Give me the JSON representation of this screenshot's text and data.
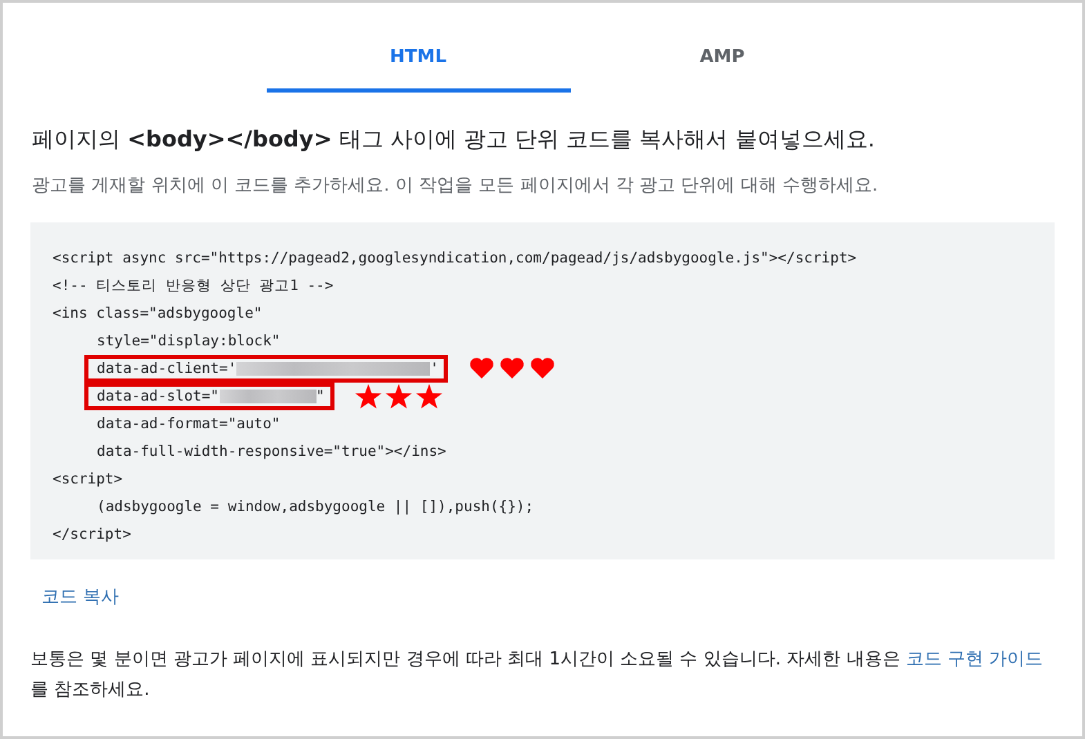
{
  "tabs": [
    {
      "label": "HTML",
      "selected": true
    },
    {
      "label": "AMP",
      "selected": false
    }
  ],
  "heading": "페이지의 **<body></body>** 태그 사이에 광고 단위 코드를 복사해서 붙여넣으세요.",
  "subtitle": "광고를 게재할 위치에 이 코드를 추가하세요. 이 작업을 모든 페이지에서 각 광고 단위에 대해 수행하세요.",
  "code_lines": [
    {
      "kind": "plain",
      "text": "<script async src=\"https://pagead2,googlesyndication,com/pagead/js/adsbygoogle.js\"></script>"
    },
    {
      "kind": "plain",
      "text": "<!-- 티스토리 반응형 상단 광고1 -->"
    },
    {
      "kind": "plain",
      "text": "<ins class=\"adsbygoogle\""
    },
    {
      "kind": "indented",
      "text": "style=\"display:block\""
    },
    {
      "kind": "indented",
      "text": "data-ad-client='",
      "redacted": true,
      "text_after": "'",
      "highlighted": true,
      "annotation": [
        {
          "kind": "heart"
        },
        {
          "kind": "heart"
        },
        {
          "kind": "heart"
        }
      ]
    },
    {
      "kind": "indented",
      "text": "data-ad-slot=\"",
      "redacted": true,
      "text_after": "\"",
      "highlighted": true,
      "annotation": [
        {
          "kind": "star"
        },
        {
          "kind": "star"
        },
        {
          "kind": "star"
        }
      ]
    },
    {
      "kind": "indented",
      "text": "data-ad-format=\"auto\""
    },
    {
      "kind": "indented",
      "text": "data-full-width-responsive=\"true\"></ins>"
    },
    {
      "kind": "plain",
      "text": "<script>"
    },
    {
      "kind": "indented",
      "text": "(adsbygoogle = window,adsbygoogle || []),push({});"
    },
    {
      "kind": "plain",
      "text": "</script>"
    }
  ],
  "copy_link": "코드 복사",
  "footer": {
    "text_before": "보통은 몇 분이면 광고가 페이지에 표시되지만 경우에 따라 최대 1시간이 소요될 수 있습니다. 자세한 내용은 ",
    "link": "코드 구현 가이드",
    "text_after": "를 참조하세요."
  }
}
